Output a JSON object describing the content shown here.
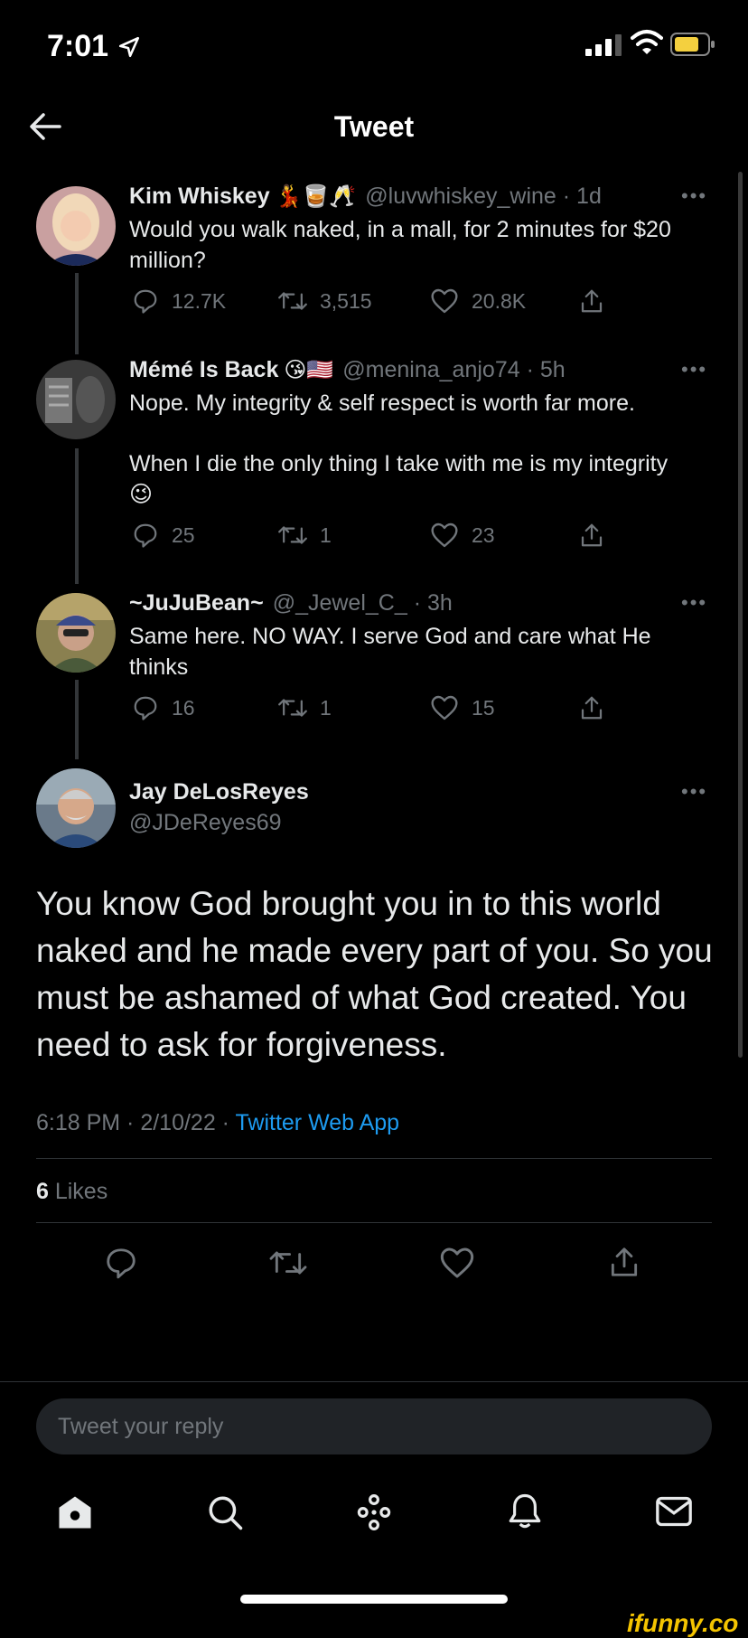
{
  "status_bar": {
    "time": "7:01"
  },
  "header": {
    "title": "Tweet"
  },
  "tweets": [
    {
      "name": "Kim Whiskey",
      "emojis": "💃🥃🥂",
      "handle": "@luvwhiskey_wine · 1d",
      "text": "Would you walk naked, in a mall, for 2 minutes for $20 million?",
      "replies": "12.7K",
      "retweets": "3,515",
      "likes": "20.8K"
    },
    {
      "name": "Mémé Is Back",
      "emojis": "😘🇺🇸",
      "handle": "@menina_anjo74 · 5h",
      "text": "Nope. My integrity & self respect is worth far more.",
      "text2": "When I die the only thing I take with me is my integrity",
      "text3": "😉",
      "replies": "25",
      "retweets": "1",
      "likes": "23"
    },
    {
      "name": "~JuJuBean~",
      "handle": "@_Jewel_C_ · 3h",
      "text": "Same here. NO WAY. I serve God and care what He thinks",
      "replies": "16",
      "retweets": "1",
      "likes": "15"
    }
  ],
  "main_tweet": {
    "name": "Jay  DeLosReyes",
    "handle": "@JDeReyes69",
    "text": "You know God brought you in to this world naked and he made every part of you. So you must be ashamed of what God created. You need to ask for forgiveness.",
    "time": "6:18 PM · 2/10/22 · ",
    "app": "Twitter Web App",
    "likes_count": "6",
    "likes_label": " Likes"
  },
  "reply": {
    "placeholder": "Tweet your reply"
  },
  "watermark": "ifunny.co",
  "colors": {
    "accent": "#1d9bf0",
    "muted": "#71767b",
    "background": "#000000"
  },
  "icons": [
    "back-arrow-icon",
    "reply-icon",
    "retweet-icon",
    "like-icon",
    "share-icon",
    "home-icon",
    "search-icon",
    "spaces-icon",
    "notifications-icon",
    "messages-icon"
  ]
}
